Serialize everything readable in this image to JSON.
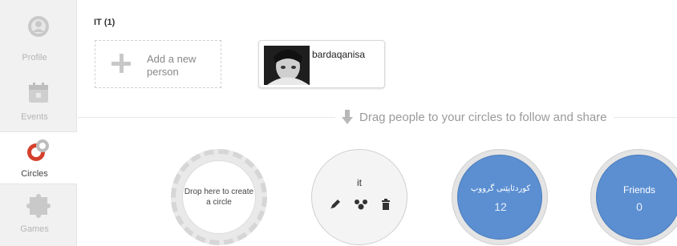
{
  "nav": {
    "items": [
      {
        "label": "Profile",
        "icon": "profile-icon"
      },
      {
        "label": "Events",
        "icon": "calendar-icon"
      },
      {
        "label": "Circles",
        "icon": "circles-icon",
        "active": true
      },
      {
        "label": "Games",
        "icon": "puzzle-icon"
      }
    ]
  },
  "circle_panel": {
    "title": "IT (1)",
    "add_person_label": "Add a new person",
    "people": [
      {
        "name": "bardaqanisa"
      }
    ]
  },
  "drag_hint": "Drag people to your circles to follow and share",
  "circles": {
    "drop_label": "Drop here to create a circle",
    "items": [
      {
        "name": "it",
        "tools": [
          "pencil-icon",
          "share-icon",
          "trash-icon"
        ]
      },
      {
        "name": "کوردئاپێنی گرووپ",
        "count": "12"
      },
      {
        "name": "Friends",
        "count": "0"
      }
    ]
  },
  "colors": {
    "circle_blue": "#5b8fd1",
    "accent_red": "#d4402c",
    "nav_bg": "#f1f1f1"
  }
}
